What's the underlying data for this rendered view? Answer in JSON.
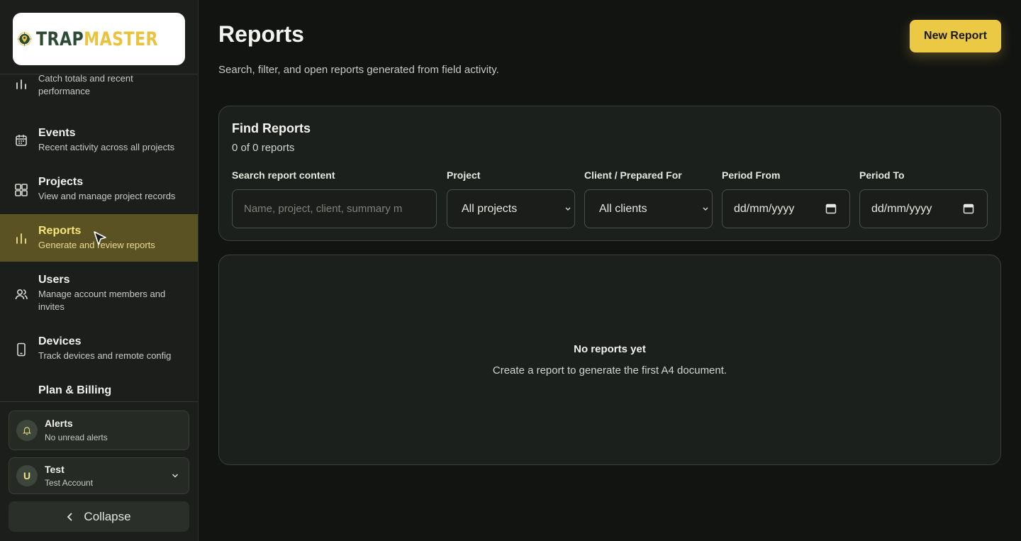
{
  "brand": {
    "name_part1": "TRAP",
    "name_part2": "MASTER"
  },
  "sidebar": {
    "items": [
      {
        "title": "",
        "subtitle": "Catch totals and recent performance",
        "icon": "bar-chart-icon"
      },
      {
        "title": "Events",
        "subtitle": "Recent activity across all projects",
        "icon": "calendar-icon"
      },
      {
        "title": "Projects",
        "subtitle": "View and manage project records",
        "icon": "grid-icon"
      },
      {
        "title": "Reports",
        "subtitle": "Generate and review reports",
        "icon": "bar-chart-icon",
        "active": true
      },
      {
        "title": "Users",
        "subtitle": "Manage account members and invites",
        "icon": "users-icon"
      },
      {
        "title": "Devices",
        "subtitle": "Track devices and remote config",
        "icon": "phone-icon"
      },
      {
        "title": "Plan & Billing",
        "subtitle": "",
        "icon": "card-icon"
      }
    ],
    "alerts": {
      "title": "Alerts",
      "subtitle": "No unread alerts"
    },
    "user": {
      "initial": "U",
      "name": "Test",
      "account": "Test Account"
    },
    "collapse_label": "Collapse"
  },
  "main": {
    "title": "Reports",
    "subtitle": "Search, filter, and open reports generated from field activity.",
    "new_report_label": "New Report",
    "find": {
      "title": "Find Reports",
      "count": "0 of 0 reports",
      "search_label": "Search report content",
      "search_placeholder": "Name, project, client, summary m",
      "project_label": "Project",
      "project_value": "All projects",
      "client_label": "Client / Prepared For",
      "client_value": "All clients",
      "period_from_label": "Period From",
      "period_from_value": "dd/mm/yyyy",
      "period_to_label": "Period To",
      "period_to_value": "dd/mm/yyyy"
    },
    "empty": {
      "title": "No reports yet",
      "subtitle": "Create a report to generate the first A4 document."
    }
  },
  "colors": {
    "accent": "#ecc944",
    "active_bg": "#5a5223",
    "brand_green": "#2d4a37"
  }
}
